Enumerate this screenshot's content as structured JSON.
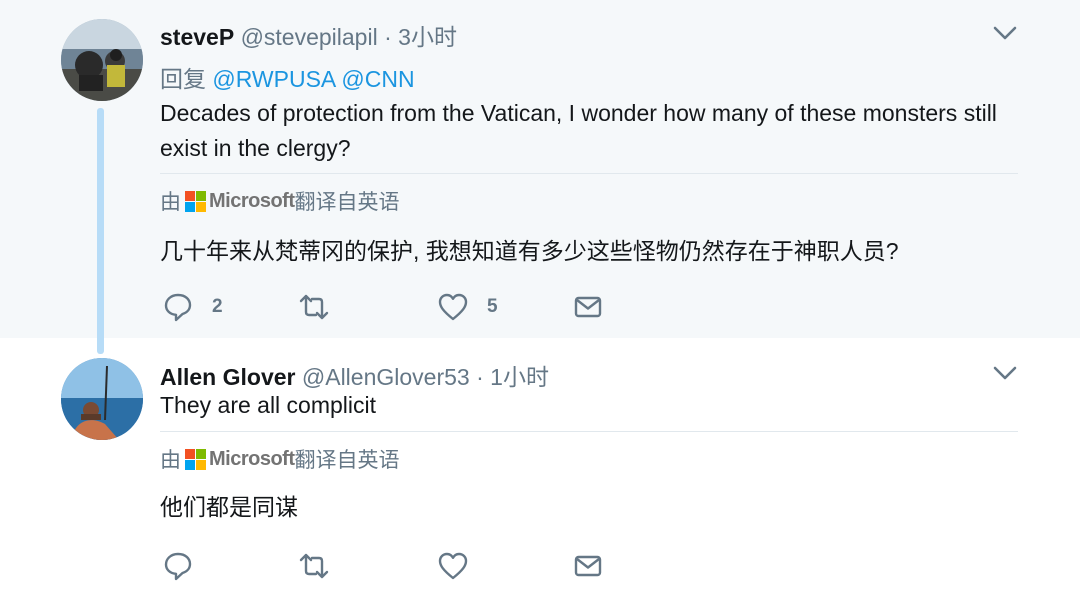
{
  "tweets": [
    {
      "name": "steveP",
      "handle": "@stevepilapil",
      "dot": " · ",
      "time": "3小时",
      "reply_prefix": "回复 ",
      "mentions": [
        "@RWPUSA",
        "@CNN"
      ],
      "text": "Decades of protection from the Vatican, I wonder how many of these monsters still exist in the clergy?",
      "translate_prefix": "由",
      "translate_brand": "Microsoft",
      "translate_suffix": "翻译自英语",
      "translated_text": "几十年来从梵蒂冈的保护, 我想知道有多少这些怪物仍然存在于神职人员?",
      "reply_count": "2",
      "retweet_count": "",
      "like_count": "5"
    },
    {
      "name": "Allen Glover",
      "handle": "@AllenGlover53",
      "dot": " · ",
      "time": "1小时",
      "text": "They are all complicit",
      "translate_prefix": "由",
      "translate_brand": "Microsoft",
      "translate_suffix": "翻译自英语",
      "translated_text": "他们都是同谋",
      "reply_count": "",
      "retweet_count": "",
      "like_count": ""
    }
  ],
  "colors": {
    "highlight_bg": "#f5f8fa",
    "link": "#1b95e0",
    "secondary_text": "#657786",
    "thread_line": "#b7dcf7",
    "ms_red": "#f25022",
    "ms_green": "#7fba00",
    "ms_blue": "#00a4ef",
    "ms_yellow": "#ffb900"
  },
  "icons": [
    "reply-icon",
    "retweet-icon",
    "like-icon",
    "direct-message-icon",
    "chevron-down-icon",
    "microsoft-logo"
  ]
}
